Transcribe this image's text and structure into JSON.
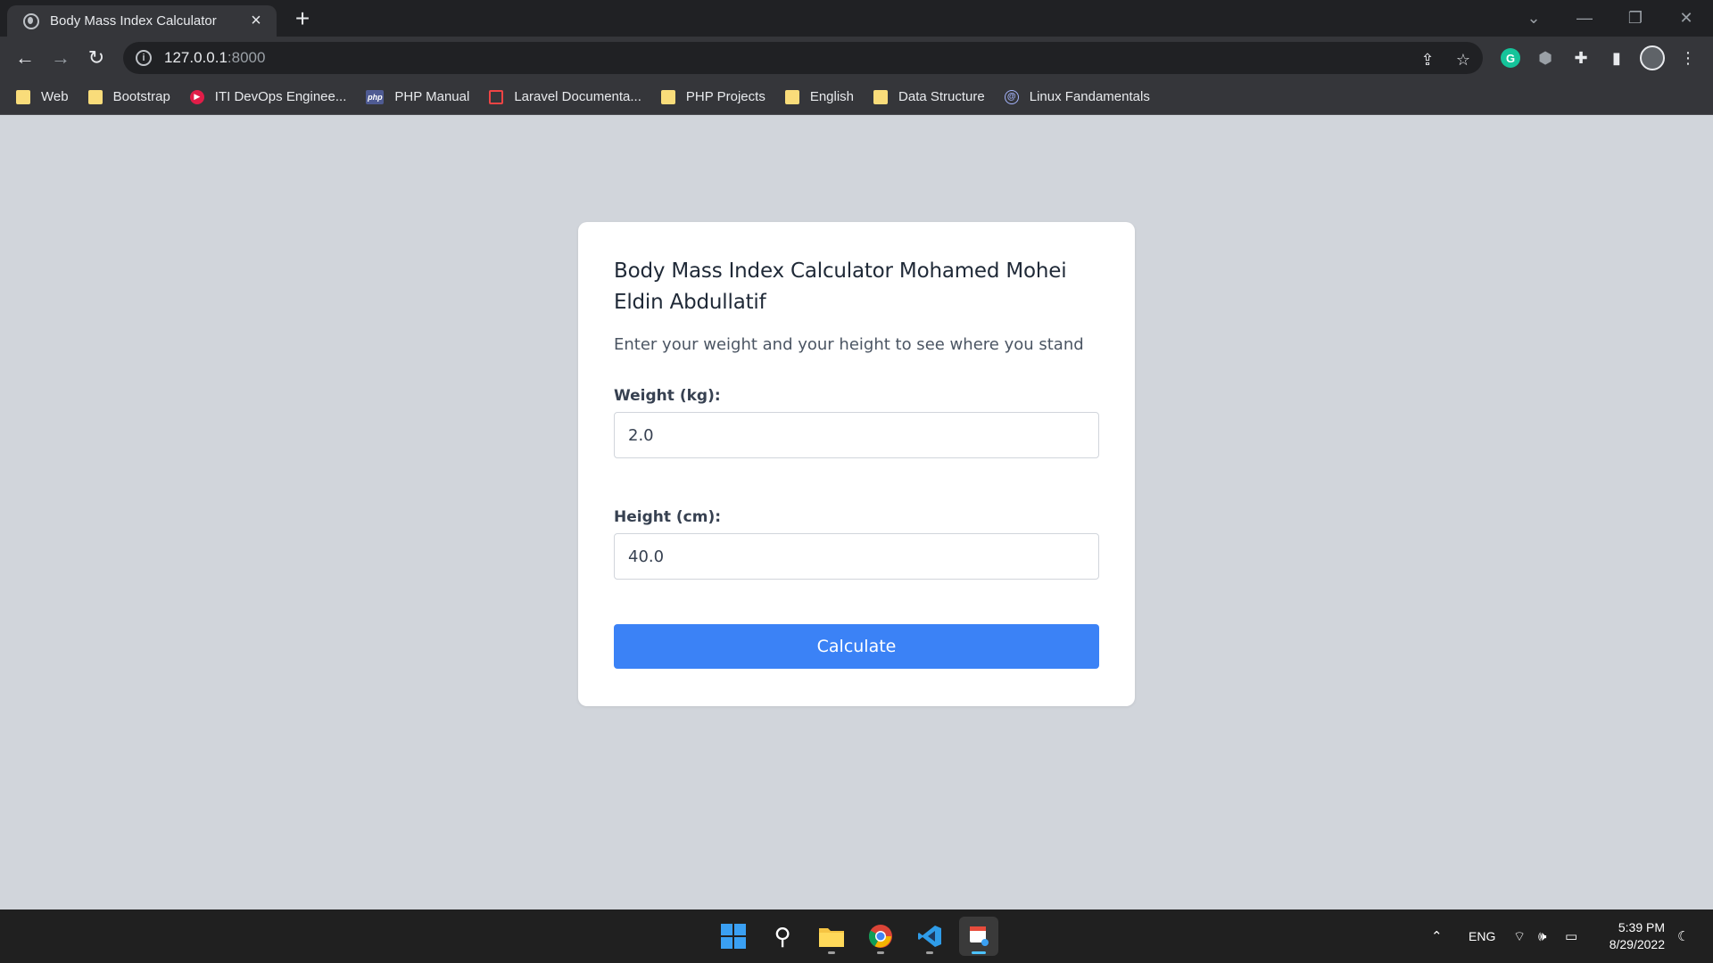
{
  "browser": {
    "tab_title": "Body Mass Index Calculator",
    "url_host": "127.0.0.1",
    "url_port": ":8000",
    "bookmarks": [
      {
        "label": "Web",
        "icon": "folder-icon"
      },
      {
        "label": "Bootstrap",
        "icon": "folder-icon"
      },
      {
        "label": "ITI DevOps Enginee...",
        "icon": "iti-icon"
      },
      {
        "label": "PHP Manual",
        "icon": "php-icon"
      },
      {
        "label": "Laravel Documenta...",
        "icon": "laravel-icon"
      },
      {
        "label": "PHP Projects",
        "icon": "folder-icon"
      },
      {
        "label": "English",
        "icon": "folder-icon"
      },
      {
        "label": "Data Structure",
        "icon": "folder-icon"
      },
      {
        "label": "Linux Fandamentals",
        "icon": "linux-icon"
      }
    ]
  },
  "form": {
    "title": "Body Mass Index Calculator Mohamed Mohei Eldin Abdullatif",
    "subtitle": "Enter your weight and your height to see where you stand",
    "weight_label": "Weight (kg):",
    "weight_value": "2.0",
    "height_label": "Height (cm):",
    "height_value": "40.0",
    "submit_label": "Calculate"
  },
  "colors": {
    "page_bg": "#d1d5db",
    "button_bg": "#3b82f6",
    "card_bg": "#ffffff"
  },
  "taskbar": {
    "language": "ENG",
    "time": "5:39 PM",
    "date": "8/29/2022"
  }
}
